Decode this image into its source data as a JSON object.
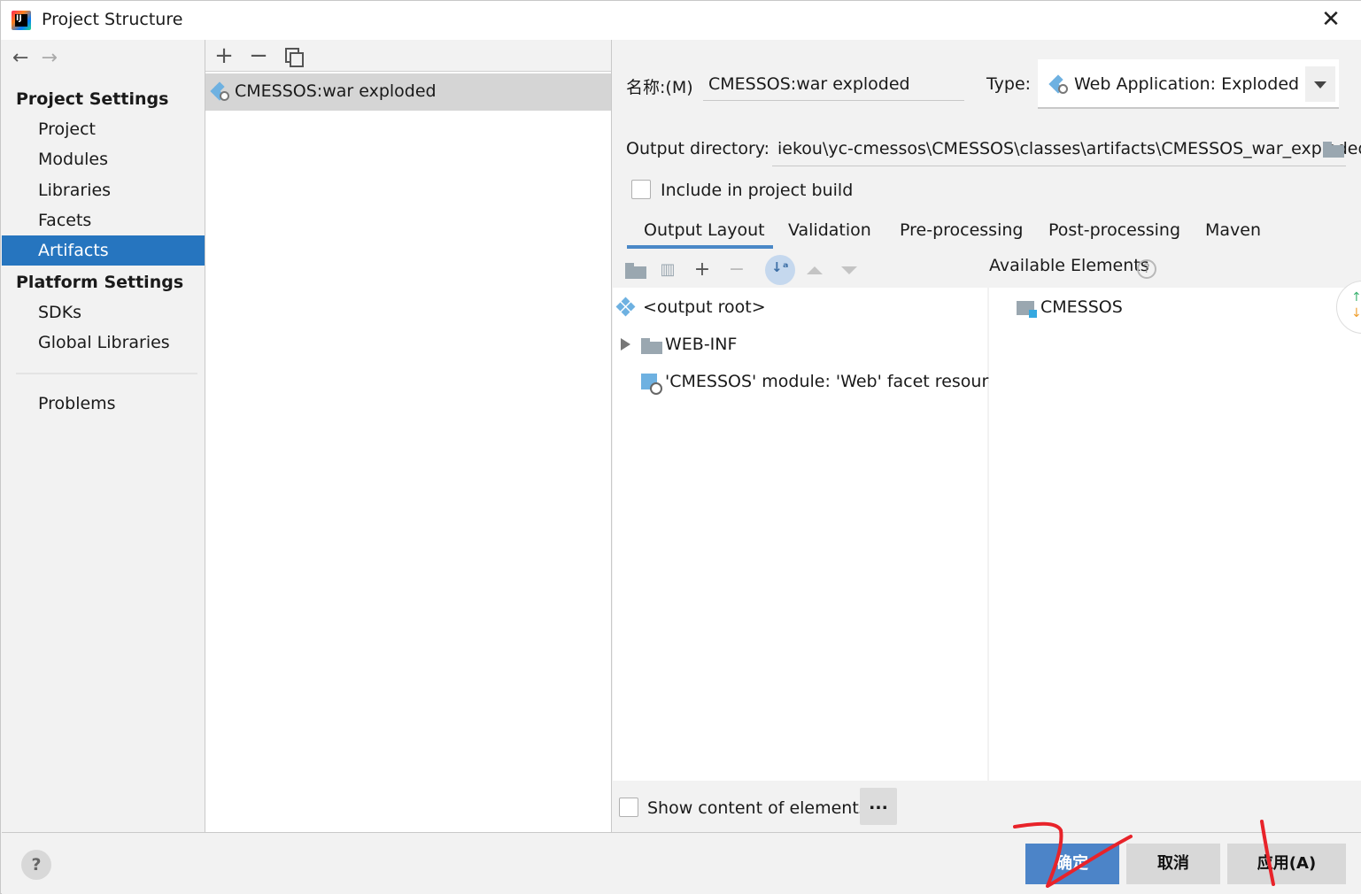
{
  "window": {
    "title": "Project Structure",
    "close_glyph": "✕"
  },
  "nav": {
    "back_glyph": "←",
    "forward_glyph": "→",
    "project_settings_heading": "Project Settings",
    "project_settings_items": [
      "Project",
      "Modules",
      "Libraries",
      "Facets",
      "Artifacts"
    ],
    "selected_item": "Artifacts",
    "platform_settings_heading": "Platform Settings",
    "platform_settings_items": [
      "SDKs",
      "Global Libraries"
    ],
    "problems": "Problems"
  },
  "artifact_list": {
    "add_glyph": "+",
    "remove_glyph": "−",
    "items": [
      "CMESSOS:war exploded"
    ]
  },
  "details": {
    "name_label": "名称:(M)",
    "name_value": "CMESSOS:war exploded",
    "type_label": "Type:",
    "type_value": "Web Application: Exploded",
    "output_dir_label": "Output directory:",
    "output_dir_value": "iekou\\yc-cmessos\\CMESSOS\\classes\\artifacts\\CMESSOS_war_exploded",
    "include_in_build_label": "Include in project build",
    "include_in_build_checked": false,
    "tabs": [
      "Output Layout",
      "Validation",
      "Pre-processing",
      "Post-processing",
      "Maven"
    ],
    "active_tab": "Output Layout",
    "available_elements_label": "Available Elements",
    "help_glyph": "?",
    "layout_tree": {
      "root": "<output root>",
      "children": [
        "WEB-INF",
        "'CMESSOS' module: 'Web' facet resources"
      ]
    },
    "available_elements": [
      "CMESSOS"
    ],
    "show_content_label": "Show content of elements",
    "show_content_checked": false,
    "more_button": "..."
  },
  "footer": {
    "help_glyph": "?",
    "ok": "确定",
    "cancel": "取消",
    "apply": "应用(A)",
    "primary_color": "#4c84c8"
  },
  "colors": {
    "selection": "#2675bf",
    "annotation": "#e8232a"
  }
}
